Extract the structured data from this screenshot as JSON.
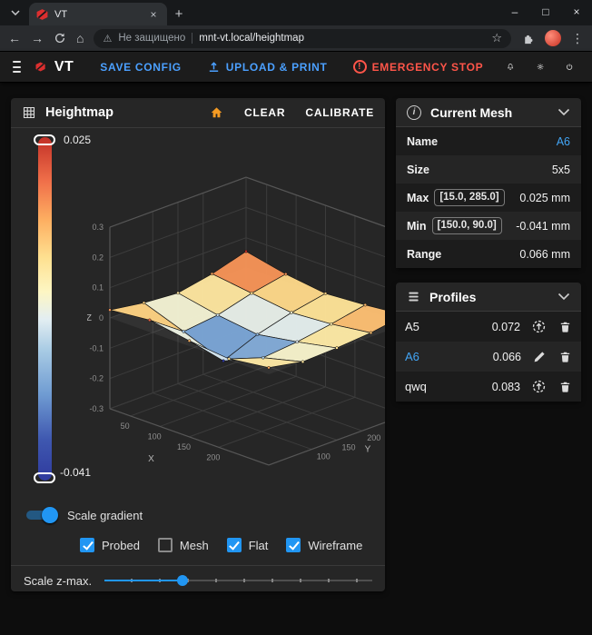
{
  "browser": {
    "tab": {
      "title": "VT"
    },
    "security_text": "Не защищено",
    "url": "mnt-vt.local/heightmap",
    "glyphs": {
      "back": "←",
      "forward": "→",
      "home": "⌂",
      "star": "☆",
      "menu": "⋮",
      "minimize": "–",
      "maximize": "□",
      "close": "×",
      "tab_close": "×",
      "new_tab": "+",
      "warning": "⚠"
    }
  },
  "app_header": {
    "logo_text": "VT",
    "save_config": "SAVE CONFIG",
    "upload_print": "UPLOAD & PRINT",
    "emergency_stop": "EMERGENCY STOP"
  },
  "icons": {
    "info": "i",
    "exclamation": "!"
  },
  "heightmap": {
    "title": "Heightmap",
    "clear": "CLEAR",
    "calibrate": "CALIBRATE",
    "colorbar": {
      "max_label": "0.025",
      "min_label": "-0.041"
    },
    "scale_gradient": {
      "label": "Scale gradient",
      "on": true
    },
    "checkboxes": [
      {
        "label": "Probed",
        "checked": true
      },
      {
        "label": "Mesh",
        "checked": false
      },
      {
        "label": "Flat",
        "checked": true
      },
      {
        "label": "Wireframe",
        "checked": true
      }
    ],
    "zmax_slider": {
      "label": "Scale z-max.",
      "value_percent": 29
    }
  },
  "chart_data": {
    "type": "surface3d",
    "title": "Heightmap",
    "x_label": "X",
    "y_label": "Y",
    "z_label": "Z",
    "x_ticks": [
      50,
      100,
      150,
      200
    ],
    "y_ticks": [
      100,
      150,
      200
    ],
    "z_ticks": [
      0.3,
      0.2,
      0.1,
      0,
      -0.1,
      -0.2,
      -0.3
    ],
    "x_range": [
      15,
      285
    ],
    "y_range": [
      15,
      285
    ],
    "z_range": [
      -0.3,
      0.3
    ],
    "probe_x": [
      15,
      82.5,
      150,
      217.5,
      285
    ],
    "probe_y": [
      15,
      82.5,
      150,
      217.5,
      285
    ],
    "z_values_front_to_back": [
      [
        0.012,
        0.018,
        0.008,
        0.002,
        0.01
      ],
      [
        0.004,
        -0.018,
        -0.041,
        -0.015,
        0.0
      ],
      [
        0.0,
        -0.012,
        -0.02,
        -0.01,
        0.002
      ],
      [
        0.01,
        0.002,
        -0.006,
        -0.002,
        0.006
      ],
      [
        0.025,
        0.012,
        0.004,
        0.008,
        0.014
      ]
    ],
    "value_min": -0.041,
    "value_max": 0.025,
    "colorscale": [
      [
        0.0,
        "#2f3a9e"
      ],
      [
        0.12,
        "#3f58b0"
      ],
      [
        0.25,
        "#6f9bd2"
      ],
      [
        0.38,
        "#a8cbe4"
      ],
      [
        0.47,
        "#e3eef2"
      ],
      [
        0.55,
        "#fdf6c3"
      ],
      [
        0.65,
        "#fee090"
      ],
      [
        0.76,
        "#fdae61"
      ],
      [
        0.87,
        "#f0704a"
      ],
      [
        1.0,
        "#c33027"
      ]
    ],
    "grid": true,
    "legend_position": "left-colorbar"
  },
  "current_mesh": {
    "title": "Current Mesh",
    "rows": [
      {
        "label": "Name",
        "chip": "",
        "value": "A6",
        "accent": true
      },
      {
        "label": "Size",
        "chip": "",
        "value": "5x5",
        "accent": false
      },
      {
        "label": "Max",
        "chip": "[15.0, 285.0]",
        "value": "0.025 mm",
        "accent": false
      },
      {
        "label": "Min",
        "chip": "[150.0, 90.0]",
        "value": "-0.041 mm",
        "accent": false
      },
      {
        "label": "Range",
        "chip": "",
        "value": "0.066 mm",
        "accent": false
      }
    ]
  },
  "profiles": {
    "title": "Profiles",
    "items": [
      {
        "name": "A5",
        "value": "0.072",
        "active": false
      },
      {
        "name": "A6",
        "value": "0.066",
        "active": true
      },
      {
        "name": "qwq",
        "value": "0.083",
        "active": false
      }
    ]
  }
}
